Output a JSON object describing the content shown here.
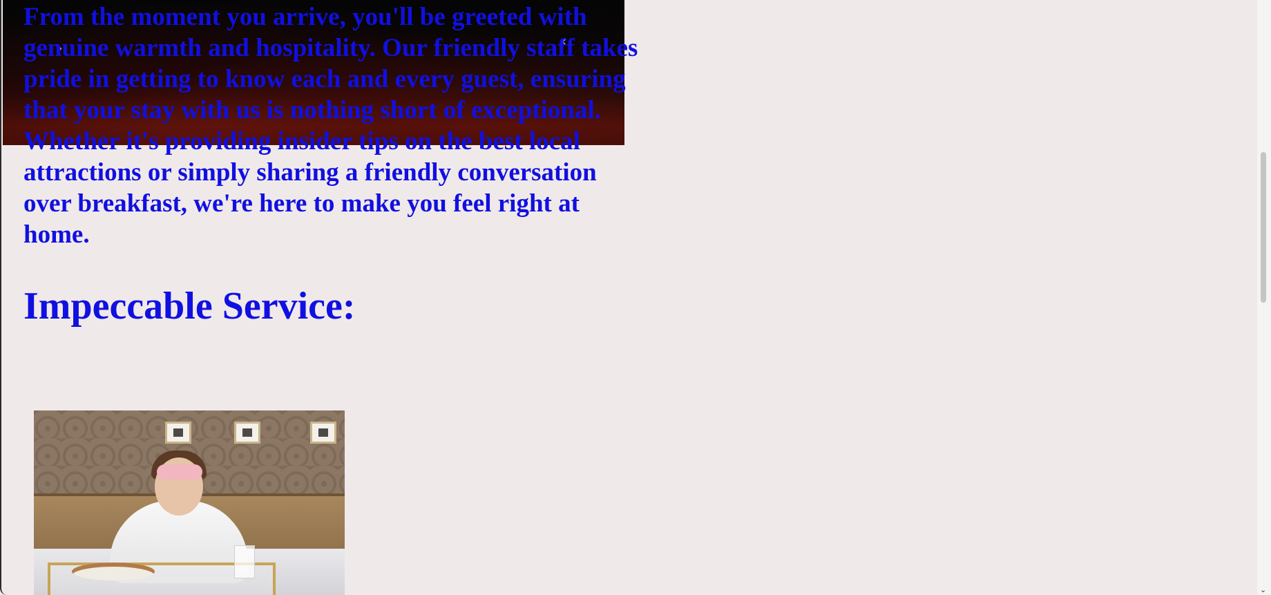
{
  "hero": {
    "prev_icon": "chevron-left-icon",
    "prev_glyph": "›",
    "next_icon": "chevron-right-icon",
    "next_glyph": "‹"
  },
  "content": {
    "intro_paragraph": "From the moment you arrive, you'll be greeted with genuine warmth and hospitality. Our friendly staff takes pride in getting to know each and every guest, ensuring that your stay with us is nothing short of exceptional. Whether it's providing insider tips on the best local attractions or simply sharing a friendly conversation over breakfast, we're here to make you feel right at home.",
    "section_heading": "Impeccable Service:"
  },
  "scrollbar": {
    "down_glyph": "⌄"
  },
  "colors": {
    "text": "#1010e0",
    "page_background": "#f0e9ea"
  }
}
